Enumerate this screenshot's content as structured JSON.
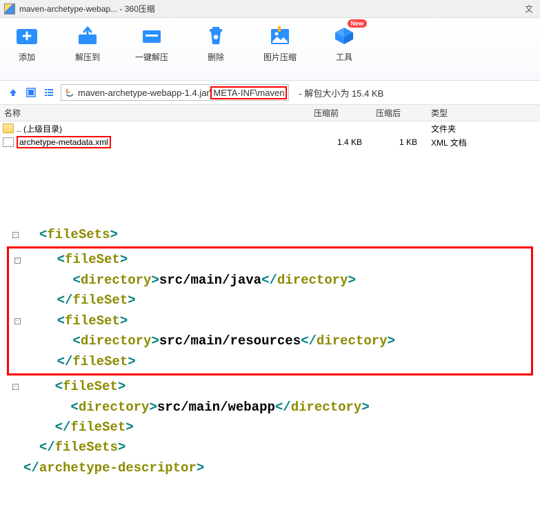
{
  "titlebar": {
    "title": "maven-archetype-webap... - 360压缩",
    "right_char": "文"
  },
  "toolbar": {
    "items": [
      {
        "label": "添加",
        "icon": "add"
      },
      {
        "label": "解压到",
        "icon": "extract"
      },
      {
        "label": "一键解压",
        "icon": "onekey"
      },
      {
        "label": "删除",
        "icon": "delete"
      },
      {
        "label": "图片压缩",
        "icon": "image"
      },
      {
        "label": "工具",
        "icon": "tool",
        "badge": "New"
      }
    ]
  },
  "navbar": {
    "path_prefix": "maven-archetype-webapp-1.4.jar\\",
    "path_highlight": "META-INF\\maven",
    "info": "- 解包大小为 15.4 KB"
  },
  "list": {
    "headers": {
      "name": "名称",
      "before": "压缩前",
      "after": "压缩后",
      "type": "类型"
    },
    "rows": [
      {
        "icon": "folder",
        "name": ".. (上级目录)",
        "before": "",
        "after": "",
        "type": "文件夹",
        "highlight": false
      },
      {
        "icon": "file",
        "name": "archetype-metadata.xml",
        "before": "1.4 KB",
        "after": "1 KB",
        "type": "XML 文档",
        "highlight": true
      }
    ]
  },
  "code": {
    "lines": [
      {
        "indent": 1,
        "gutter": "box",
        "parts": [
          [
            "<",
            "b"
          ],
          [
            "fileSets",
            "n"
          ],
          [
            ">",
            "b"
          ]
        ]
      },
      {
        "indent": 2,
        "gutter": "box",
        "red_start": true,
        "parts": [
          [
            "<",
            "b"
          ],
          [
            "fileSet",
            "n"
          ],
          [
            ">",
            "b"
          ]
        ]
      },
      {
        "indent": 3,
        "gutter": "",
        "red_mid": true,
        "parts": [
          [
            "<",
            "b"
          ],
          [
            "directory",
            "n"
          ],
          [
            ">",
            "b"
          ],
          [
            "src/main/java",
            "t"
          ],
          [
            "</",
            "b"
          ],
          [
            "directory",
            "n"
          ],
          [
            ">",
            "b"
          ]
        ]
      },
      {
        "indent": 2,
        "gutter": "",
        "red_mid": true,
        "parts": [
          [
            "</",
            "b"
          ],
          [
            "fileSet",
            "n"
          ],
          [
            ">",
            "b"
          ]
        ]
      },
      {
        "indent": 2,
        "gutter": "box",
        "red_mid": true,
        "parts": [
          [
            "<",
            "b"
          ],
          [
            "fileSet",
            "n"
          ],
          [
            ">",
            "b"
          ]
        ]
      },
      {
        "indent": 3,
        "gutter": "",
        "red_mid": true,
        "parts": [
          [
            "<",
            "b"
          ],
          [
            "directory",
            "n"
          ],
          [
            ">",
            "b"
          ],
          [
            "src/main/resources",
            "t"
          ],
          [
            "</",
            "b"
          ],
          [
            "directory",
            "n"
          ],
          [
            ">",
            "b"
          ]
        ]
      },
      {
        "indent": 2,
        "gutter": "",
        "red_end": true,
        "parts": [
          [
            "</",
            "b"
          ],
          [
            "fileSet",
            "n"
          ],
          [
            ">",
            "b"
          ]
        ]
      },
      {
        "indent": 2,
        "gutter": "box",
        "parts": [
          [
            "<",
            "b"
          ],
          [
            "fileSet",
            "n"
          ],
          [
            ">",
            "b"
          ]
        ]
      },
      {
        "indent": 3,
        "gutter": "",
        "parts": [
          [
            "<",
            "b"
          ],
          [
            "directory",
            "n"
          ],
          [
            ">",
            "b"
          ],
          [
            "src/main/webapp",
            "t"
          ],
          [
            "</",
            "b"
          ],
          [
            "directory",
            "n"
          ],
          [
            ">",
            "b"
          ]
        ]
      },
      {
        "indent": 2,
        "gutter": "",
        "parts": [
          [
            "</",
            "b"
          ],
          [
            "fileSet",
            "n"
          ],
          [
            ">",
            "b"
          ]
        ]
      },
      {
        "indent": 1,
        "gutter": "",
        "parts": [
          [
            "</",
            "b"
          ],
          [
            "fileSets",
            "n"
          ],
          [
            ">",
            "b"
          ]
        ]
      },
      {
        "indent": 0,
        "gutter": "",
        "parts": [
          [
            "</",
            "b"
          ],
          [
            "archetype-descriptor",
            "n"
          ],
          [
            ">",
            "b"
          ]
        ]
      }
    ]
  }
}
